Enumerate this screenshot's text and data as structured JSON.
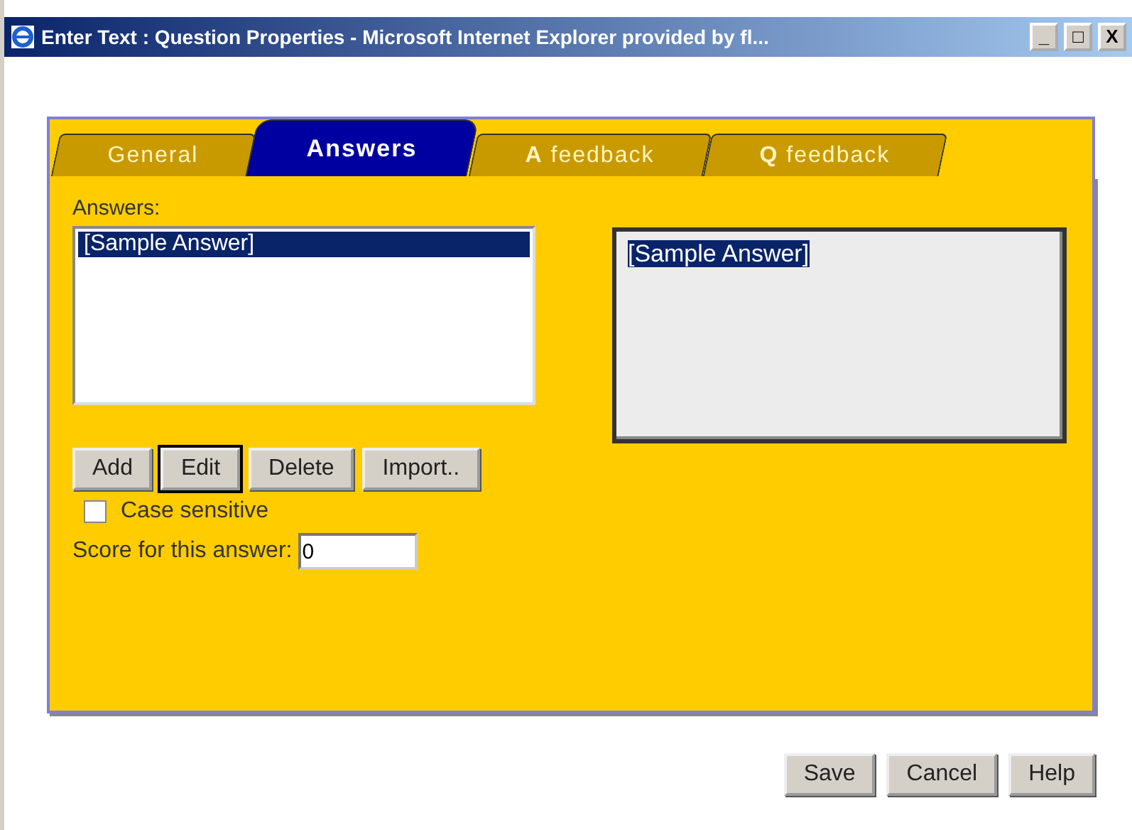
{
  "window": {
    "title": "Enter Text : Question Properties - Microsoft Internet Explorer provided by fl...",
    "controls": [
      "_",
      "□",
      "X"
    ]
  },
  "tabs": [
    {
      "label": "General",
      "selected": false
    },
    {
      "label": "Answers",
      "selected": true
    },
    {
      "label": "**A** feedback",
      "selected": false
    },
    {
      "label": "**Q** feedback",
      "selected": false
    }
  ],
  "answers": {
    "label": "Answers:",
    "items": [
      {
        "text": "[Sample Answer]",
        "selected": true
      }
    ]
  },
  "editor": {
    "text": "[Sample Answer]",
    "highlighted": true
  },
  "buttons": [
    {
      "label": "Add",
      "focused": false
    },
    {
      "label": "Edit",
      "focused": true
    },
    {
      "label": "Delete",
      "focused": false
    },
    {
      "label": "Import..",
      "focused": false
    }
  ],
  "case_sensitive": {
    "label": "Case sensitive",
    "checked": false
  },
  "score": {
    "label": "Score for this answer:",
    "value": "0"
  },
  "footer_buttons": [
    "Save",
    "Cancel",
    "Help"
  ]
}
